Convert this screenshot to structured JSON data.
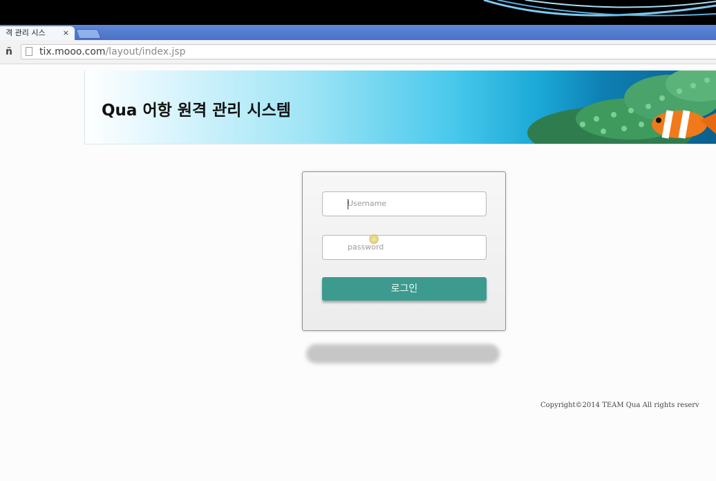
{
  "browser": {
    "tab_title": "격 관리 시스",
    "tab_close": "×",
    "url_host": "tix.mooo.com",
    "url_path": "/layout/index.jsp"
  },
  "banner": {
    "title": "Qua 어항 원격 관리 시스템"
  },
  "login": {
    "username_placeholder": "Username",
    "password_placeholder": "password",
    "button_label": "로그인"
  },
  "footer": {
    "copyright": "Copyright©2014 TEAM Qua All rights reserv"
  },
  "colors": {
    "button": "#3d9a8f",
    "tabstrip": "#4a72c6"
  }
}
